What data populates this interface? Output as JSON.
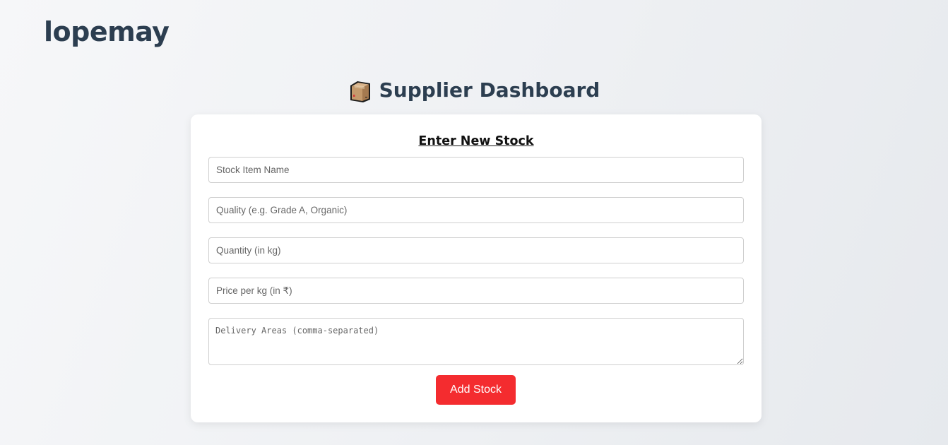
{
  "brand": "lopemay",
  "header": {
    "title": "Supplier Dashboard",
    "icon": "package-box-icon"
  },
  "form": {
    "title": "Enter New Stock",
    "fields": {
      "item_name": {
        "placeholder": "Stock Item Name",
        "value": ""
      },
      "quality": {
        "placeholder": "Quality (e.g. Grade A, Organic)",
        "value": ""
      },
      "quantity": {
        "placeholder": "Quantity (in kg)",
        "value": ""
      },
      "price": {
        "placeholder": "Price per kg (in ₹)",
        "value": ""
      },
      "delivery_areas": {
        "placeholder": "Delivery Areas (comma-separated)",
        "value": ""
      }
    },
    "submit_label": "Add Stock"
  },
  "colors": {
    "brand_text": "#2c3e50",
    "button_bg": "#f42c2f",
    "card_bg": "#ffffff"
  }
}
